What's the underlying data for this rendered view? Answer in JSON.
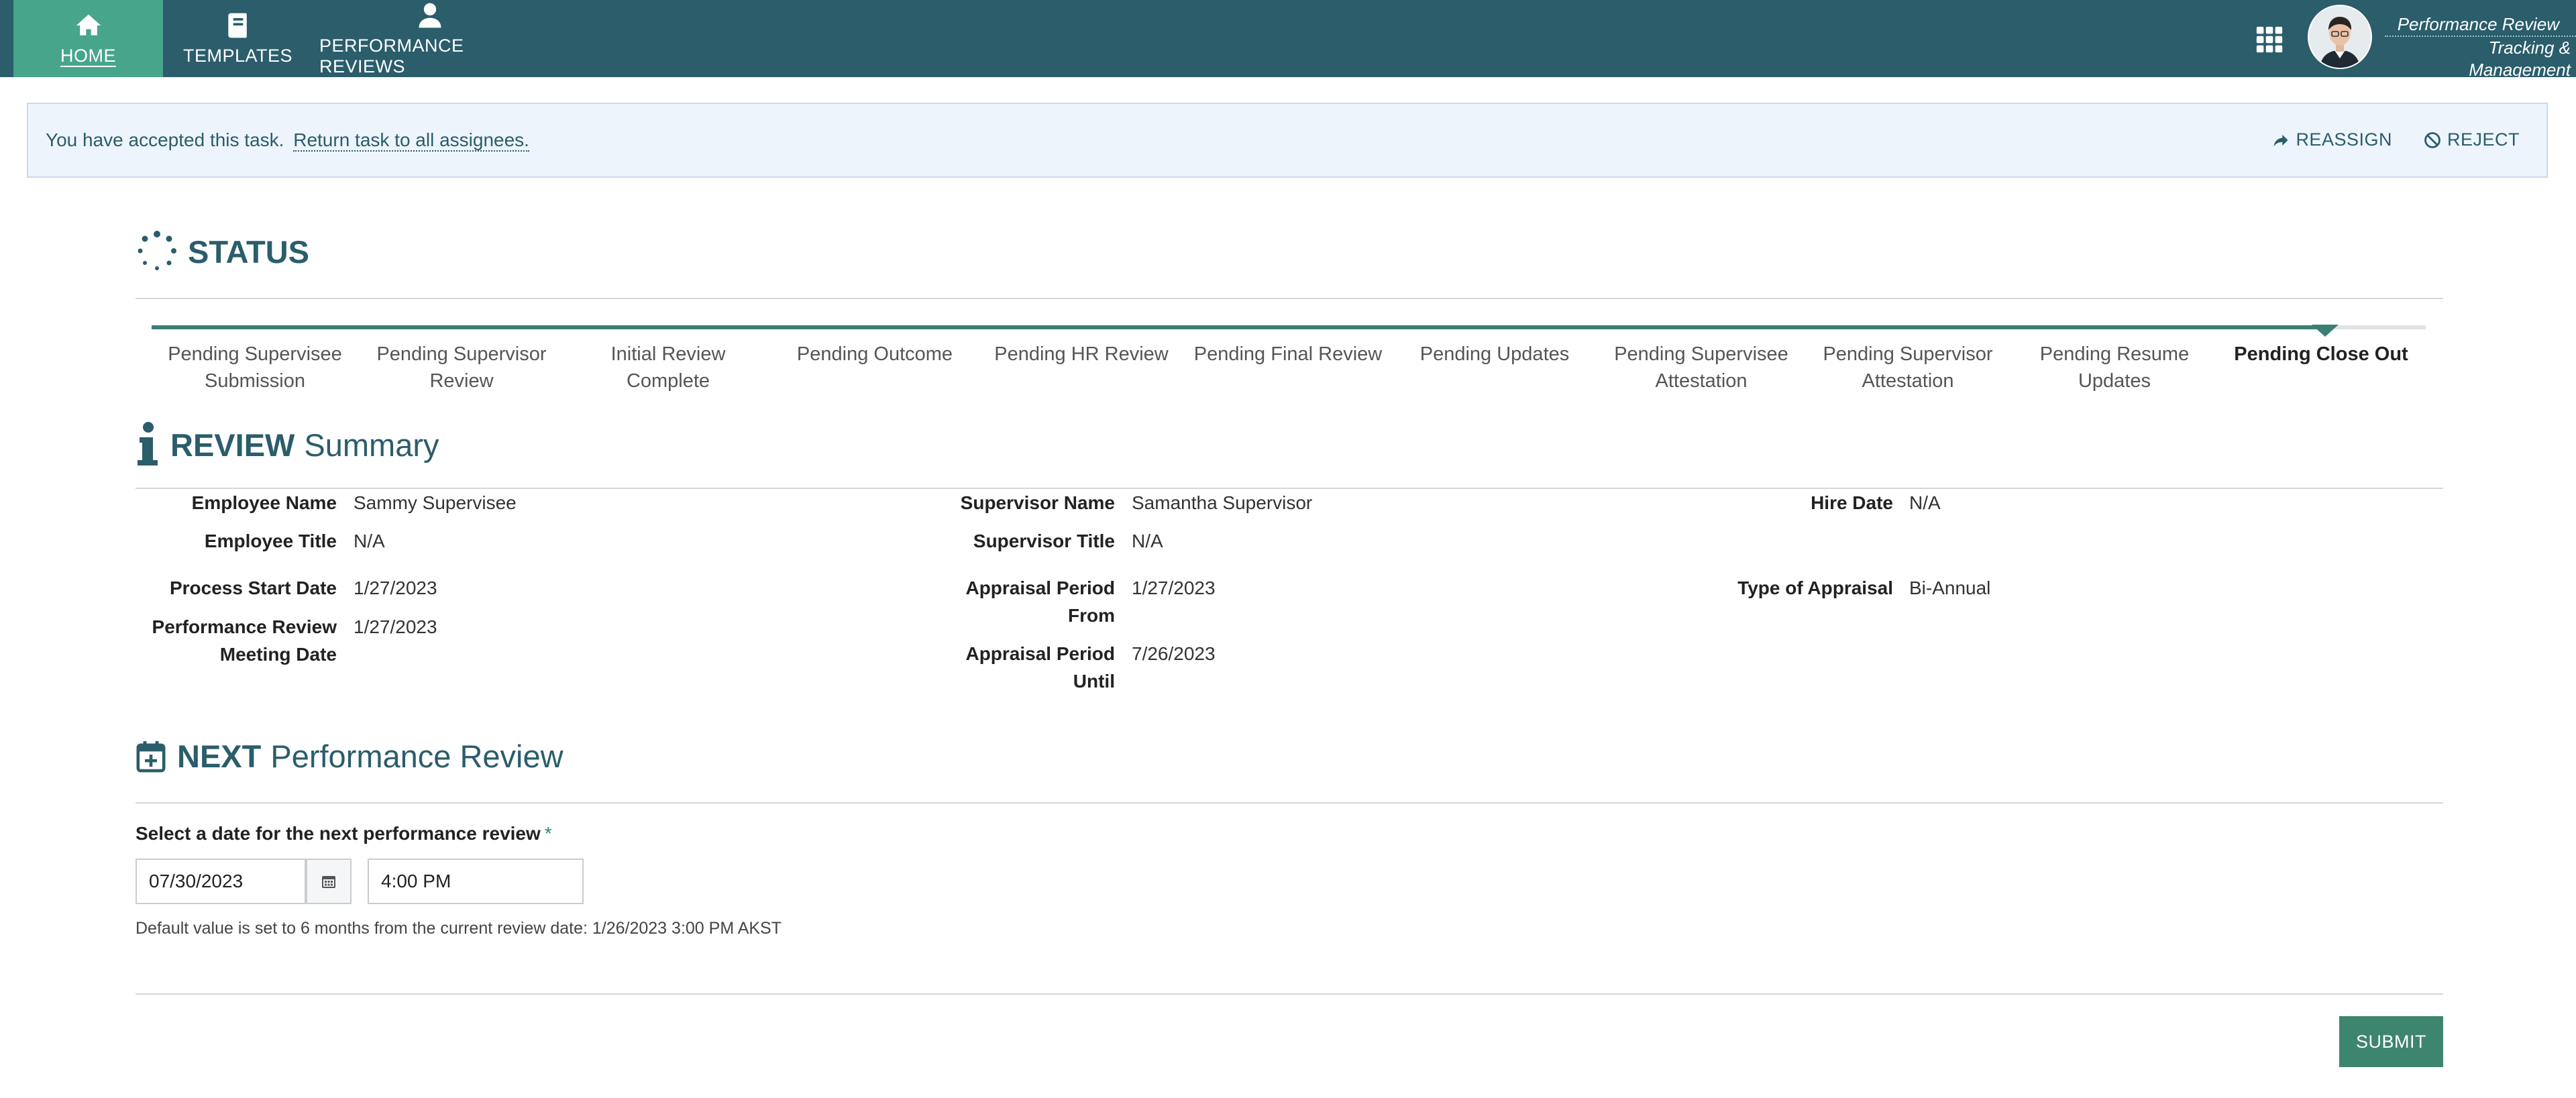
{
  "nav": {
    "items": [
      {
        "label": "HOME",
        "icon": "home-icon"
      },
      {
        "label": "TEMPLATES",
        "icon": "book-icon"
      },
      {
        "label": "PERFORMANCE REVIEWS",
        "icon": "person-icon"
      }
    ],
    "brand_line1": "Performance Review",
    "brand_line2": "Tracking & Management"
  },
  "notice": {
    "text": "You have accepted this task.",
    "link": "Return task to all assignees.",
    "reassign": "REASSIGN",
    "reject": "REJECT"
  },
  "status": {
    "title": "STATUS",
    "steps": [
      "Pending Supervisee Submission",
      "Pending Supervisor Review",
      "Initial Review Complete",
      "Pending Outcome",
      "Pending HR Review",
      "Pending Final Review",
      "Pending Updates",
      "Pending Supervisee Attestation",
      "Pending Supervisor Attestation",
      "Pending Resume Updates",
      "Pending Close Out"
    ],
    "current_step": "Pending Close Out"
  },
  "summary": {
    "title_bold": "REVIEW",
    "title_light": "Summary",
    "employee_name_label": "Employee Name",
    "employee_name": "Sammy Supervisee",
    "employee_title_label": "Employee Title",
    "employee_title": "N/A",
    "process_start_label": "Process Start Date",
    "process_start": "1/27/2023",
    "meeting_label": "Performance Review Meeting Date",
    "meeting_date": "1/27/2023",
    "supervisor_name_label": "Supervisor Name",
    "supervisor_name": "Samantha Supervisor",
    "supervisor_title_label": "Supervisor Title",
    "supervisor_title": "N/A",
    "period_from_label": "Appraisal Period From",
    "period_from": "1/27/2023",
    "period_until_label": "Appraisal Period Until",
    "period_until": "7/26/2023",
    "hire_date_label": "Hire Date",
    "hire_date": "N/A",
    "appraisal_type_label": "Type of Appraisal",
    "appraisal_type": "Bi-Annual"
  },
  "next": {
    "title_bold": "NEXT",
    "title_light": "Performance Review",
    "date_label": "Select a date for the next performance review",
    "required_mark": "*",
    "date_value": "07/30/2023",
    "time_value": "4:00 PM",
    "hint": "Default value is set to 6 months from the current review date: 1/26/2023 3:00 PM AKST",
    "submit_label": "SUBMIT"
  },
  "colors": {
    "header": "#2b5d6b",
    "nav_active": "#47a58c",
    "accent": "#3e8570",
    "notice_bg": "#edf4fc"
  }
}
